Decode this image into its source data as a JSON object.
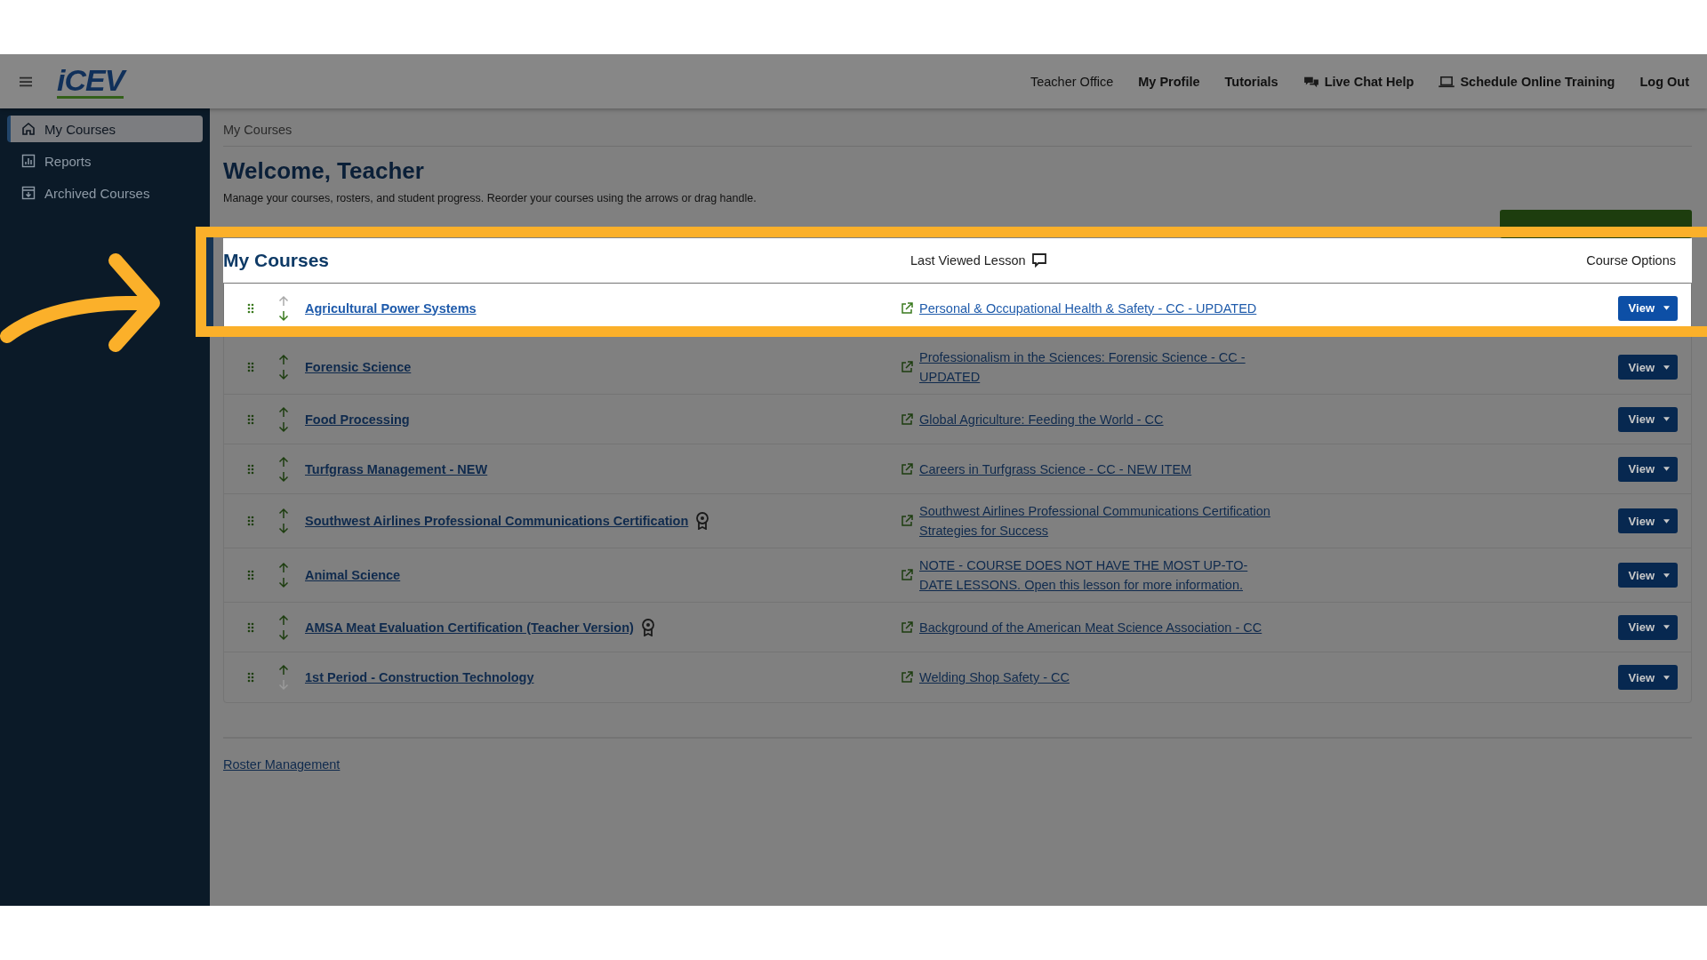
{
  "nav": {
    "logo": "iCEV",
    "links": [
      {
        "label": "Teacher Office",
        "kind": "plain"
      },
      {
        "label": "My Profile",
        "kind": "bold"
      },
      {
        "label": "Tutorials",
        "kind": "bold"
      },
      {
        "label": "Live Chat Help",
        "kind": "chat"
      },
      {
        "label": "Schedule Online Training",
        "kind": "monitor"
      },
      {
        "label": "Log Out",
        "kind": "bold"
      }
    ]
  },
  "sidebar": {
    "items": [
      {
        "label": "My Courses",
        "kind": "home",
        "selected": true
      },
      {
        "label": "Reports",
        "kind": "chart",
        "selected": false
      },
      {
        "label": "Archived Courses",
        "kind": "archive",
        "selected": false
      }
    ]
  },
  "breadcrumb": "My Courses",
  "title": "Welcome, Teacher",
  "subtitle": "Manage your courses, rosters, and student progress. Reorder your courses using the arrows or drag handle.",
  "courses_card": {
    "title": "My Courses",
    "last_viewed_header": "Last Viewed Lesson",
    "options_header": "Course Options",
    "rows": [
      {
        "name": "Agricultural Power Systems",
        "highlighted": true,
        "certification": false,
        "up_enabled": false,
        "down_enabled": true,
        "lesson": "Personal & Occupational Health & Safety - CC - UPDATED",
        "button": "View"
      },
      {
        "name": "Forensic Science",
        "highlighted": false,
        "certification": false,
        "up_enabled": true,
        "down_enabled": true,
        "lesson": "Professionalism in the Sciences: Forensic Science - CC - UPDATED",
        "button": "View"
      },
      {
        "name": "Food Processing",
        "highlighted": false,
        "certification": false,
        "up_enabled": true,
        "down_enabled": true,
        "lesson": "Global Agriculture: Feeding the World - CC",
        "button": "View"
      },
      {
        "name": "Turfgrass Management - NEW",
        "highlighted": false,
        "certification": false,
        "up_enabled": true,
        "down_enabled": true,
        "lesson": "Careers in Turfgrass Science - CC - NEW ITEM",
        "button": "View"
      },
      {
        "name": "Southwest Airlines Professional Communications Certification",
        "highlighted": false,
        "certification": true,
        "up_enabled": true,
        "down_enabled": true,
        "lesson": "Southwest Airlines Professional Communications Certification Strategies for Success",
        "button": "View"
      },
      {
        "name": "Animal Science",
        "highlighted": false,
        "certification": false,
        "up_enabled": true,
        "down_enabled": true,
        "lesson": "NOTE - COURSE DOES NOT HAVE THE MOST UP-TO-DATE LESSONS. Open this lesson for more information.",
        "button": "View"
      },
      {
        "name": "AMSA Meat Evaluation Certification (Teacher Version)",
        "highlighted": false,
        "certification": true,
        "up_enabled": true,
        "down_enabled": true,
        "lesson": "Background of the American Meat Science Association - CC",
        "button": "View"
      },
      {
        "name": "1st Period - Construction Technology",
        "highlighted": false,
        "certification": false,
        "up_enabled": true,
        "down_enabled": false,
        "lesson": "Welding Shop Safety - CC",
        "button": "View"
      }
    ]
  },
  "roster_link": "Roster Management"
}
